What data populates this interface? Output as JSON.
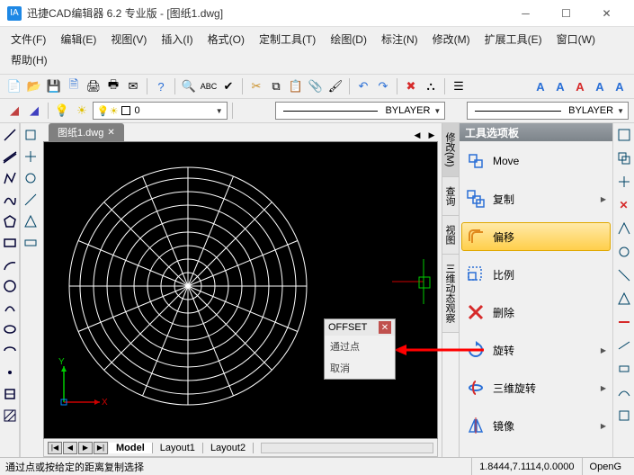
{
  "title": "迅捷CAD编辑器 6.2 专业版  - [图纸1.dwg]",
  "app_logo": "IA",
  "menus": [
    "文件(F)",
    "编辑(E)",
    "视图(V)",
    "插入(I)",
    "格式(O)",
    "定制工具(T)",
    "绘图(D)",
    "标注(N)",
    "修改(M)",
    "扩展工具(E)",
    "窗口(W)",
    "帮助(H)"
  ],
  "doc_tab": "图纸1.dwg",
  "layer_combo": "0",
  "bylayer1": "BYLAYER",
  "bylayer2": "BYLAYER",
  "popup": {
    "title": "OFFSET",
    "items": [
      "通过点",
      "取消"
    ]
  },
  "rightpanel": {
    "title": "工具选项板",
    "vtabs": [
      "修改(M)",
      "查询",
      "视图",
      "三维动态观察"
    ],
    "items": [
      {
        "label": "Move",
        "color": "#2a6fd6",
        "hl": false,
        "more": false
      },
      {
        "label": "复制",
        "color": "#2a6fd6",
        "hl": false,
        "more": true
      },
      {
        "label": "偏移",
        "color": "#e08a1e",
        "hl": true,
        "more": false
      },
      {
        "label": "比例",
        "color": "#2a6fd6",
        "hl": false,
        "more": false
      },
      {
        "label": "删除",
        "color": "#d62a2a",
        "hl": false,
        "more": false
      },
      {
        "label": "旋转",
        "color": "#2a6fd6",
        "hl": false,
        "more": true
      },
      {
        "label": "三维旋转",
        "color": "#2a6fd6",
        "hl": false,
        "more": true
      },
      {
        "label": "镜像",
        "color": "#2a6fd6",
        "hl": false,
        "more": true
      }
    ]
  },
  "bottom_tabs": [
    "Model",
    "Layout1",
    "Layout2"
  ],
  "status_left": "通过点或按给定的距离复制选择",
  "status_coords": "1.8444,7.1114,0.0000",
  "status_mode": "OpenG"
}
